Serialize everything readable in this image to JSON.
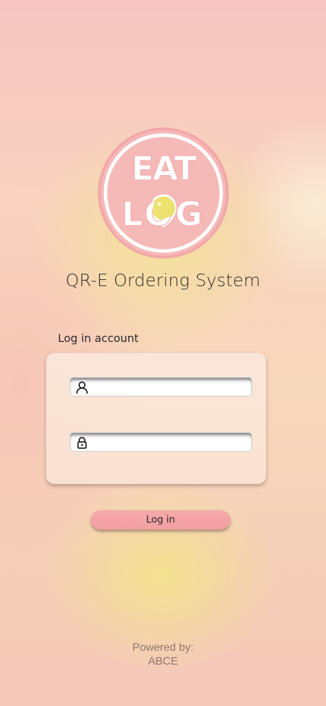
{
  "logo": {
    "line1": "EAT",
    "line2": "LOG"
  },
  "app_title": "QR-E Ordering System",
  "login_form": {
    "heading": "Log in account",
    "username": {
      "value": "",
      "placeholder": "",
      "icon": "user-icon"
    },
    "password": {
      "value": "",
      "placeholder": "",
      "icon": "lock-icon"
    },
    "submit_label": "Log in"
  },
  "footer": {
    "powered_by_label": "Powered by:",
    "company": "ABCE"
  },
  "colors": {
    "brand_pink": "#f4b7b8",
    "button_pink": "#f39fa2",
    "egg_yolk": "#ede16f"
  }
}
